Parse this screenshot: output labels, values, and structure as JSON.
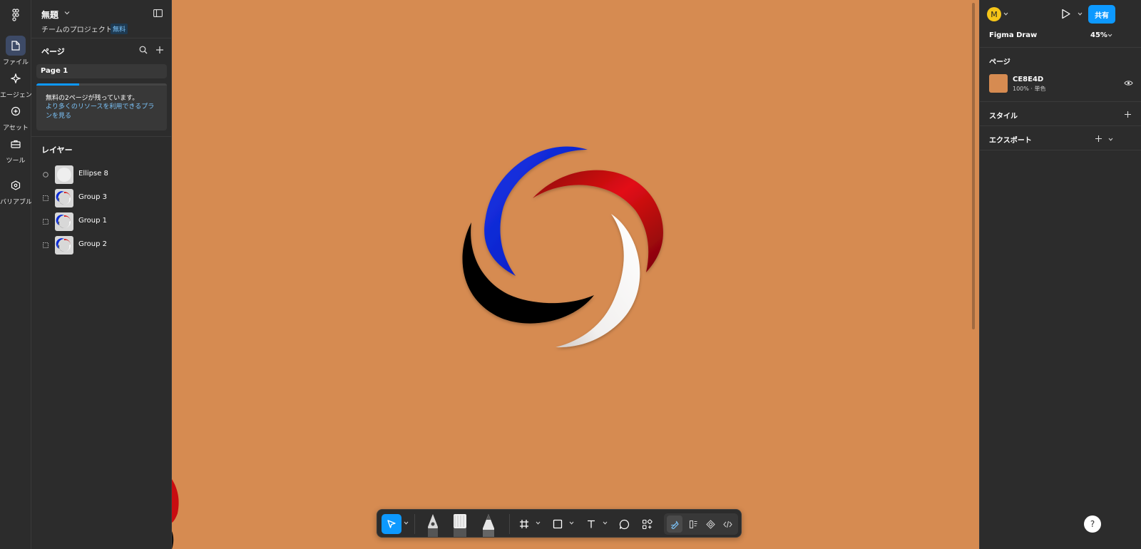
{
  "file": {
    "title": "無題",
    "project": "チームのプロジェクト",
    "plan_badge": "無料"
  },
  "rail": {
    "items": [
      {
        "label": "ファイル",
        "icon": "file-icon"
      },
      {
        "label": "エージェント",
        "icon": "agent-sparkle-icon"
      },
      {
        "label": "アセット",
        "icon": "assets-icon"
      },
      {
        "label": "ツール",
        "icon": "toolbox-icon"
      },
      {
        "label": "バリアブル",
        "icon": "variables-icon"
      }
    ]
  },
  "pages": {
    "title": "ページ",
    "items": [
      "Page 1"
    ],
    "quota_notice": "無料の2ページが残っています。",
    "upgrade_link": "より多くのリソースを利用できるプランを見る",
    "quota_used_fraction": 0.33
  },
  "layers": {
    "title": "レイヤー",
    "items": [
      {
        "name": "Ellipse 8",
        "kind": "ellipse"
      },
      {
        "name": "Group 3",
        "kind": "group"
      },
      {
        "name": "Group 1",
        "kind": "group"
      },
      {
        "name": "Group 2",
        "kind": "group"
      }
    ]
  },
  "canvas": {
    "background": "#D68B51"
  },
  "toolbar": {
    "tools": [
      "move-tool",
      "pen-tool",
      "brush-tool",
      "pencil-tool",
      "frame-tool",
      "shape-tool",
      "text-tool",
      "comment-tool",
      "actions-tool",
      "draw-mode",
      "design-mode",
      "prototype-mode",
      "dev-mode"
    ]
  },
  "right_panel": {
    "avatar_initial": "M",
    "share_label": "共有",
    "mode_label": "Figma Draw",
    "zoom": "45%",
    "page_section": "ページ",
    "page_fill_hex": "CE8E4D",
    "page_fill_meta": "100% · 単色",
    "styles_section": "スタイル",
    "export_section": "エクスポート",
    "help_label": "?"
  },
  "colors": {
    "accent": "#0d99ff",
    "panel": "#2c2c2c",
    "blue_swirl": "#0a2bd6",
    "red_swirl": "#d80f12",
    "black_swirl": "#000000",
    "white_swirl": "#f2efee"
  }
}
